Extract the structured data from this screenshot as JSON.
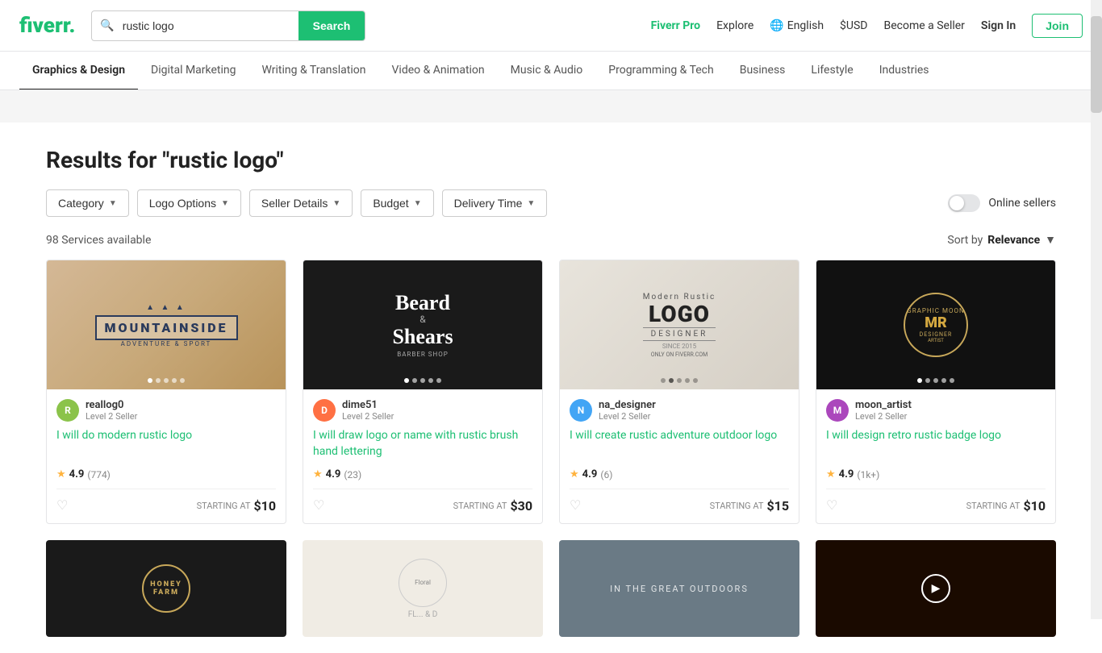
{
  "header": {
    "logo": "fiverr",
    "logo_dot": ".",
    "search_placeholder": "rustic logo",
    "search_value": "rustic logo",
    "search_btn": "Search",
    "fiverr_pro": "Fiverr Pro",
    "explore": "Explore",
    "language": "English",
    "currency": "$USD",
    "become_seller": "Become a Seller",
    "sign_in": "Sign In",
    "join": "Join"
  },
  "nav": {
    "items": [
      {
        "label": "Graphics & Design",
        "active": true
      },
      {
        "label": "Digital Marketing",
        "active": false
      },
      {
        "label": "Writing & Translation",
        "active": false
      },
      {
        "label": "Video & Animation",
        "active": false
      },
      {
        "label": "Music & Audio",
        "active": false
      },
      {
        "label": "Programming & Tech",
        "active": false
      },
      {
        "label": "Business",
        "active": false
      },
      {
        "label": "Lifestyle",
        "active": false
      },
      {
        "label": "Industries",
        "active": false
      }
    ]
  },
  "results": {
    "title": "Results for \"rustic logo\"",
    "count": "98 Services available",
    "sort_label": "Sort by",
    "sort_value": "Relevance"
  },
  "filters": [
    {
      "label": "Category",
      "id": "category"
    },
    {
      "label": "Logo Options",
      "id": "logo-options"
    },
    {
      "label": "Seller Details",
      "id": "seller-details"
    },
    {
      "label": "Budget",
      "id": "budget"
    },
    {
      "label": "Delivery Time",
      "id": "delivery-time"
    }
  ],
  "online_sellers": {
    "label": "Online sellers"
  },
  "cards": [
    {
      "id": 1,
      "seller_name": "reallog0",
      "seller_level": "Level 2 Seller",
      "title": "I will do modern rustic logo",
      "rating": "4.9",
      "reviews": "(774)",
      "price": "$10",
      "starting_at": "STARTING AT",
      "dots": 5,
      "active_dot": 0,
      "avatar_letter": "R",
      "avatar_class": "avatar-1"
    },
    {
      "id": 2,
      "seller_name": "dime51",
      "seller_level": "Level 2 Seller",
      "title": "I will draw logo or name with rustic brush hand lettering",
      "rating": "4.9",
      "reviews": "(23)",
      "price": "$30",
      "starting_at": "STARTING AT",
      "dots": 5,
      "active_dot": 0,
      "avatar_letter": "D",
      "avatar_class": "avatar-2"
    },
    {
      "id": 3,
      "seller_name": "na_designer",
      "seller_level": "Level 2 Seller",
      "title": "I will create rustic adventure outdoor logo",
      "rating": "4.9",
      "reviews": "(6)",
      "price": "$15",
      "starting_at": "STARTING AT",
      "dots": 5,
      "active_dot": 0,
      "avatar_letter": "N",
      "avatar_class": "avatar-3"
    },
    {
      "id": 4,
      "seller_name": "moon_artist",
      "seller_level": "Level 2 Seller",
      "title": "I will design retro rustic badge logo",
      "rating": "4.9",
      "reviews": "(1k+)",
      "price": "$10",
      "starting_at": "STARTING AT",
      "dots": 5,
      "active_dot": 0,
      "avatar_letter": "M",
      "avatar_class": "avatar-4"
    }
  ]
}
